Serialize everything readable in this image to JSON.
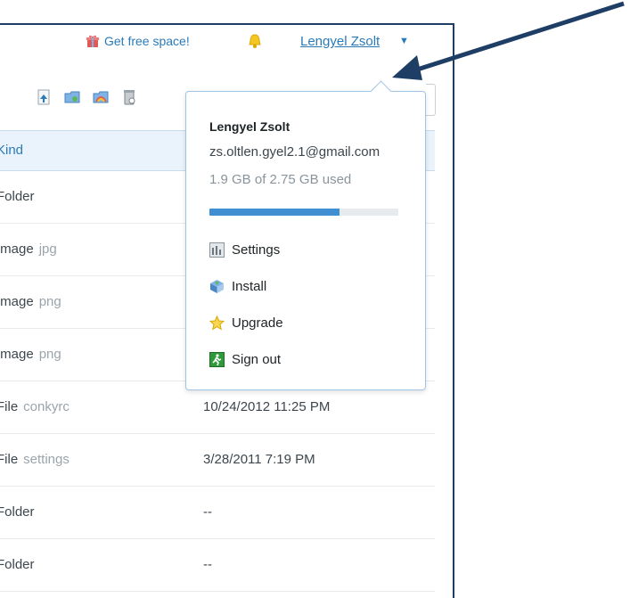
{
  "header": {
    "free_space_label": "Get free space!",
    "user_name": "Lengyel Zsolt",
    "caret": "▼"
  },
  "table": {
    "kind_header": "Kind",
    "rows": [
      {
        "kind": "Folder",
        "ext": "",
        "modified": ""
      },
      {
        "kind": "Image",
        "ext": "jpg",
        "modified": ""
      },
      {
        "kind": "Image",
        "ext": "png",
        "modified": ""
      },
      {
        "kind": "Image",
        "ext": "png",
        "modified": ""
      },
      {
        "kind": "File",
        "ext": "conkyrc",
        "modified": "10/24/2012 11:25 PM"
      },
      {
        "kind": "File",
        "ext": "settings",
        "modified": "3/28/2011 7:19 PM"
      },
      {
        "kind": "Folder",
        "ext": "",
        "modified": "--"
      },
      {
        "kind": "Folder",
        "ext": "",
        "modified": "--"
      }
    ]
  },
  "account_menu": {
    "name": "Lengyel Zsolt",
    "email": "zs.oltlen.gyel2.1@gmail.com",
    "usage": "1.9 GB of 2.75 GB used",
    "usage_fraction": 0.69,
    "items": [
      {
        "label": "Settings",
        "icon": "settings-icon"
      },
      {
        "label": "Install",
        "icon": "install-icon"
      },
      {
        "label": "Upgrade",
        "icon": "upgrade-star-icon"
      },
      {
        "label": "Sign out",
        "icon": "sign-out-icon"
      }
    ]
  },
  "colors": {
    "link": "#2a7ab8",
    "bar_fill": "#3f8fd2",
    "arrow": "#1f3e66"
  }
}
